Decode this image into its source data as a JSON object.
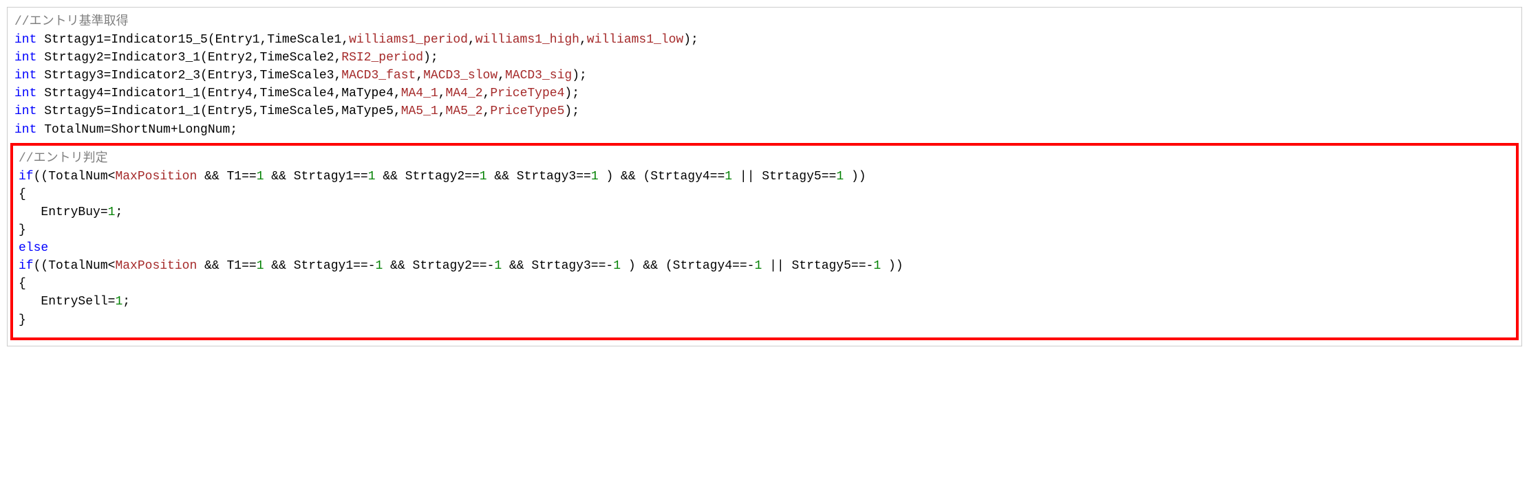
{
  "section1": {
    "comment": "//エントリ基準取得",
    "lines": [
      {
        "kw": "int",
        "seg": [
          {
            "t": "plain",
            "v": " Strtagy1=Indicator15_5(Entry1,TimeScale1,"
          },
          {
            "t": "param",
            "v": "williams1_period"
          },
          {
            "t": "plain",
            "v": ","
          },
          {
            "t": "param",
            "v": "williams1_high"
          },
          {
            "t": "plain",
            "v": ","
          },
          {
            "t": "param",
            "v": "williams1_low"
          },
          {
            "t": "plain",
            "v": ");"
          }
        ]
      },
      {
        "kw": "int",
        "seg": [
          {
            "t": "plain",
            "v": " Strtagy2=Indicator3_1(Entry2,TimeScale2,"
          },
          {
            "t": "param",
            "v": "RSI2_period"
          },
          {
            "t": "plain",
            "v": ");"
          }
        ]
      },
      {
        "kw": "int",
        "seg": [
          {
            "t": "plain",
            "v": " Strtagy3=Indicator2_3(Entry3,TimeScale3,"
          },
          {
            "t": "param",
            "v": "MACD3_fast"
          },
          {
            "t": "plain",
            "v": ","
          },
          {
            "t": "param",
            "v": "MACD3_slow"
          },
          {
            "t": "plain",
            "v": ","
          },
          {
            "t": "param",
            "v": "MACD3_sig"
          },
          {
            "t": "plain",
            "v": ");"
          }
        ]
      },
      {
        "kw": "int",
        "seg": [
          {
            "t": "plain",
            "v": " Strtagy4=Indicator1_1(Entry4,TimeScale4,MaType4,"
          },
          {
            "t": "param",
            "v": "MA4_1"
          },
          {
            "t": "plain",
            "v": ","
          },
          {
            "t": "param",
            "v": "MA4_2"
          },
          {
            "t": "plain",
            "v": ","
          },
          {
            "t": "param",
            "v": "PriceType4"
          },
          {
            "t": "plain",
            "v": ");"
          }
        ]
      },
      {
        "kw": "int",
        "seg": [
          {
            "t": "plain",
            "v": " Strtagy5=Indicator1_1(Entry5,TimeScale5,MaType5,"
          },
          {
            "t": "param",
            "v": "MA5_1"
          },
          {
            "t": "plain",
            "v": ","
          },
          {
            "t": "param",
            "v": "MA5_2"
          },
          {
            "t": "plain",
            "v": ","
          },
          {
            "t": "param",
            "v": "PriceType5"
          },
          {
            "t": "plain",
            "v": ");"
          }
        ]
      },
      {
        "kw": "int",
        "seg": [
          {
            "t": "plain",
            "v": " TotalNum=ShortNum+LongNum;"
          }
        ]
      }
    ]
  },
  "section2": {
    "comment": "//エントリ判定",
    "l1": {
      "if": "if",
      "seg": [
        {
          "t": "plain",
          "v": "((TotalNum<"
        },
        {
          "t": "param",
          "v": "MaxPosition"
        },
        {
          "t": "plain",
          "v": " && T1=="
        },
        {
          "t": "num",
          "v": "1"
        },
        {
          "t": "plain",
          "v": " && Strtagy1=="
        },
        {
          "t": "num",
          "v": "1"
        },
        {
          "t": "plain",
          "v": " && Strtagy2=="
        },
        {
          "t": "num",
          "v": "1"
        },
        {
          "t": "plain",
          "v": " && Strtagy3=="
        },
        {
          "t": "num",
          "v": "1"
        },
        {
          "t": "plain",
          "v": " ) && (Strtagy4=="
        },
        {
          "t": "num",
          "v": "1"
        },
        {
          "t": "plain",
          "v": " || Strtagy5=="
        },
        {
          "t": "num",
          "v": "1"
        },
        {
          "t": "plain",
          "v": " ))"
        }
      ]
    },
    "brace_open1": "{",
    "body1": {
      "seg": [
        {
          "t": "plain",
          "v": "   EntryBuy="
        },
        {
          "t": "num",
          "v": "1"
        },
        {
          "t": "plain",
          "v": ";"
        }
      ]
    },
    "brace_close1": "}",
    "else": "else",
    "l2": {
      "if": "if",
      "seg": [
        {
          "t": "plain",
          "v": "((TotalNum<"
        },
        {
          "t": "param",
          "v": "MaxPosition"
        },
        {
          "t": "plain",
          "v": " && T1=="
        },
        {
          "t": "num",
          "v": "1"
        },
        {
          "t": "plain",
          "v": " && Strtagy1==-"
        },
        {
          "t": "num",
          "v": "1"
        },
        {
          "t": "plain",
          "v": " && Strtagy2==-"
        },
        {
          "t": "num",
          "v": "1"
        },
        {
          "t": "plain",
          "v": " && Strtagy3==-"
        },
        {
          "t": "num",
          "v": "1"
        },
        {
          "t": "plain",
          "v": " ) && (Strtagy4==-"
        },
        {
          "t": "num",
          "v": "1"
        },
        {
          "t": "plain",
          "v": " || Strtagy5==-"
        },
        {
          "t": "num",
          "v": "1"
        },
        {
          "t": "plain",
          "v": " ))"
        }
      ]
    },
    "brace_open2": "{",
    "body2": {
      "seg": [
        {
          "t": "plain",
          "v": "   EntrySell="
        },
        {
          "t": "num",
          "v": "1"
        },
        {
          "t": "plain",
          "v": ";"
        }
      ]
    },
    "brace_close2": "}"
  }
}
